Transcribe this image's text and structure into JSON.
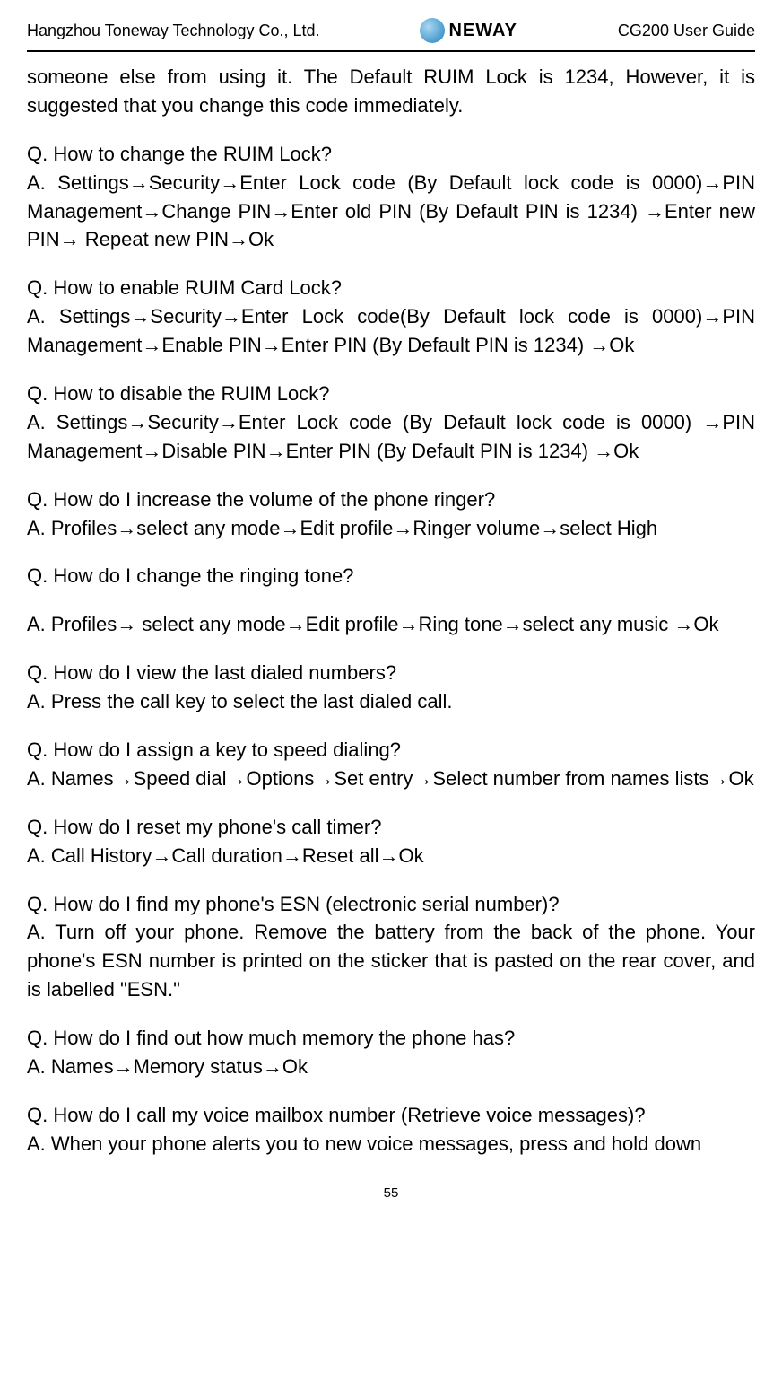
{
  "header": {
    "company": "Hangzhou Toneway Technology Co., Ltd.",
    "logo_text": "NEWAY",
    "guide": "CG200 User Guide"
  },
  "intro": "someone else from using it. The Default RUIM Lock is 1234, However, it is suggested that you change this code immediately.",
  "qa": [
    {
      "q": "Q. How to change the RUIM Lock?",
      "a": "A. Settings→Security→Enter Lock code (By Default lock code is 0000)→PIN Management→Change PIN→Enter old PIN (By Default PIN is 1234) →Enter new PIN→ Repeat new PIN→Ok"
    },
    {
      "q": "Q. How to enable RUIM Card Lock?",
      "a": "A. Settings→Security→Enter Lock code(By Default lock code is 0000)→PIN Management→Enable PIN→Enter PIN (By Default PIN is 1234) →Ok"
    },
    {
      "q": "Q. How to disable the RUIM Lock?",
      "a": "A. Settings→Security→Enter Lock code (By Default lock code is 0000) →PIN Management→Disable PIN→Enter PIN (By Default PIN is 1234) →Ok"
    },
    {
      "q": "Q. How do I increase the volume of the phone ringer?",
      "a": "A. Profiles→select any mode→Edit profile→Ringer volume→select High"
    },
    {
      "q": "Q. How do I change the ringing tone?",
      "a": "A. Profiles→ select any mode→Edit profile→Ring tone→select any music →Ok"
    },
    {
      "q": "Q. How do I view the last dialed numbers?",
      "a": "A. Press the call key to select the last dialed call."
    },
    {
      "q": "Q. How do I assign a key to speed dialing?",
      "a": "A. Names→Speed dial→Options→Set entry→Select number from names lists→Ok"
    },
    {
      "q": "Q. How do I reset my phone's call timer?",
      "a": "A. Call History→Call duration→Reset all→Ok"
    },
    {
      "q": "Q. How do I find my phone's ESN (electronic serial number)?",
      "a": "A. Turn off your phone. Remove the battery from the back of the phone. Your phone's ESN number is printed on the sticker that is pasted on the rear cover, and is labelled \"ESN.\""
    },
    {
      "q": "Q. How do I find out how much memory the phone has?",
      "a": "A. Names→Memory status→Ok"
    },
    {
      "q": "Q. How do I call my voice mailbox number (Retrieve voice messages)?",
      "a": "A. When your phone alerts you to new voice messages, press and hold down"
    }
  ],
  "page_number": "55"
}
